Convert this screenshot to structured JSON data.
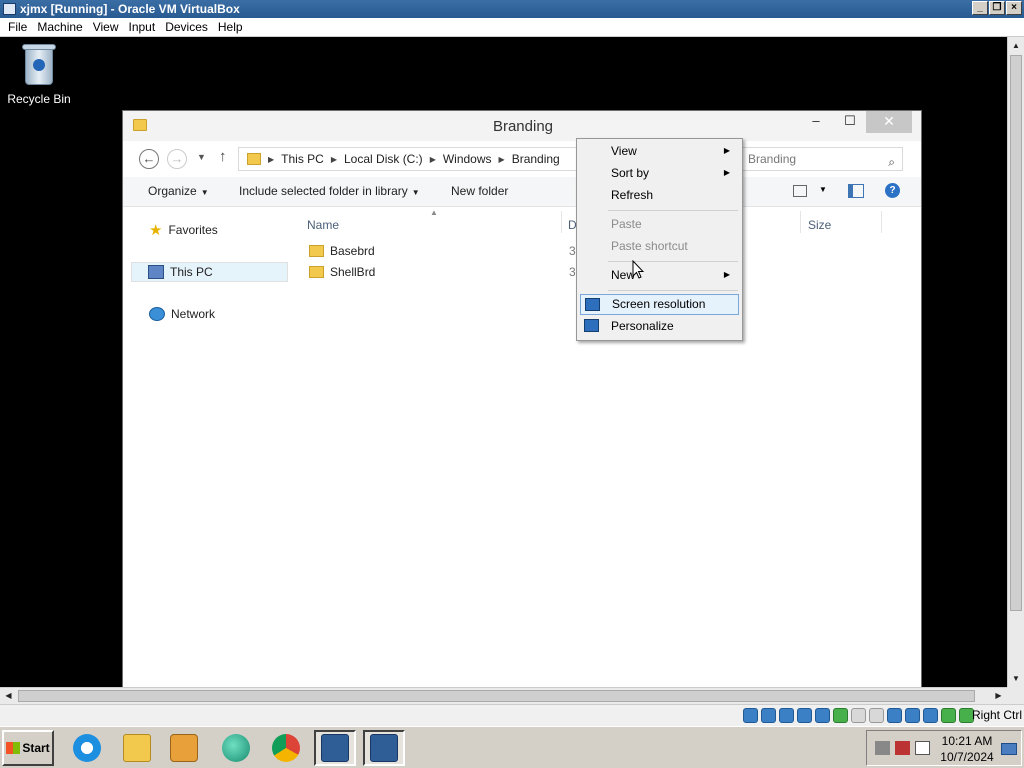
{
  "host": {
    "title": "xjmx [Running] - Oracle VM VirtualBox",
    "menu": [
      "File",
      "Machine",
      "View",
      "Input",
      "Devices",
      "Help"
    ],
    "status_right": "Right Ctrl"
  },
  "desktop": {
    "recycle_bin_label": "Recycle Bin"
  },
  "explorer": {
    "title": "Branding",
    "breadcrumbs": [
      "This PC",
      "Local Disk (C:)",
      "Windows",
      "Branding"
    ],
    "search_placeholder": "Branding",
    "toolbar": {
      "organize": "Organize",
      "include": "Include selected folder in library",
      "new_folder": "New folder"
    },
    "nav": {
      "favorites": "Favorites",
      "this_pc": "This PC",
      "network": "Network"
    },
    "columns": {
      "name": "Name",
      "date": "D",
      "size": "Size"
    },
    "files": [
      {
        "name": "Basebrd",
        "date": "3,"
      },
      {
        "name": "ShellBrd",
        "date": "3,"
      }
    ]
  },
  "context_menu": {
    "items": [
      {
        "label": "View",
        "submenu": true,
        "disabled": false
      },
      {
        "label": "Sort by",
        "submenu": true,
        "disabled": false
      },
      {
        "label": "Refresh",
        "submenu": false,
        "disabled": false
      },
      {
        "label": "Paste",
        "submenu": false,
        "disabled": true
      },
      {
        "label": "Paste shortcut",
        "submenu": false,
        "disabled": true
      },
      {
        "label": "New",
        "submenu": true,
        "disabled": false
      },
      {
        "label": "Screen resolution",
        "submenu": false,
        "disabled": false,
        "highlighted": true
      },
      {
        "label": "Personalize",
        "submenu": false,
        "disabled": false
      }
    ]
  },
  "taskbar": {
    "start_label": "Start",
    "clock_time": "10:21 AM",
    "clock_date": "10/7/2024",
    "apps": [
      "internet-explorer",
      "file-explorer",
      "media-player",
      "browser",
      "chrome",
      "virtualbox",
      "virtualbox"
    ]
  },
  "colors": {
    "highlight": "#e5f1fb",
    "accent": "#3a6ea5"
  }
}
